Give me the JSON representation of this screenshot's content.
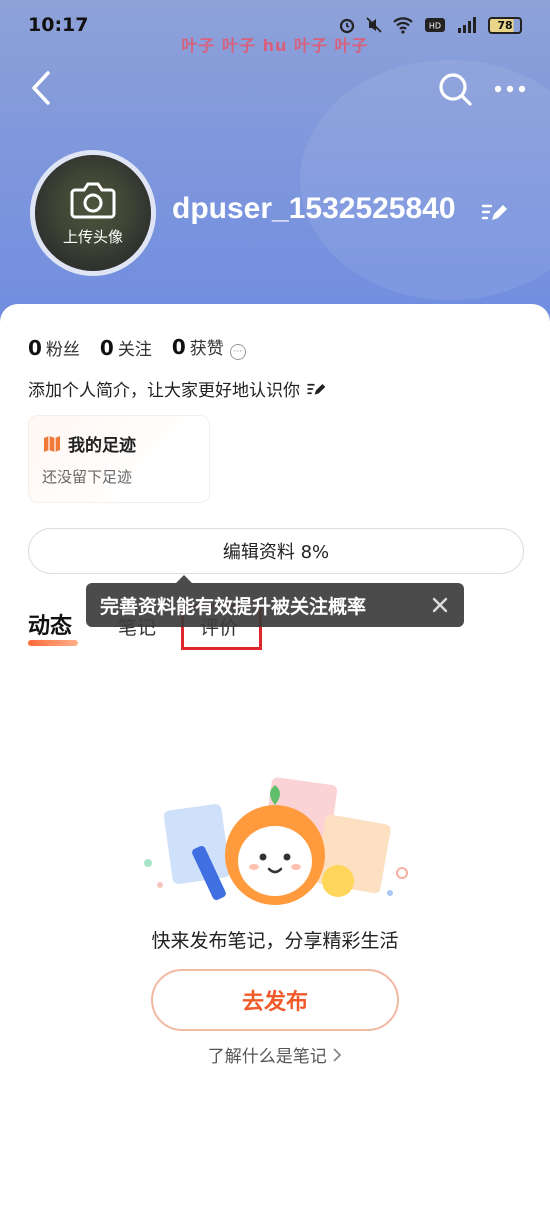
{
  "status_bar": {
    "time": "10:17",
    "battery": "78",
    "icons": [
      "alarm-icon",
      "mute-icon",
      "wifi-icon",
      "hd-icon",
      "signal-icon",
      "battery-icon"
    ]
  },
  "watermark": "叶子 叶子 hu 叶子 叶子",
  "nav": {
    "back_icon": "chevron-left-icon",
    "search_icon": "search-icon",
    "more_icon": "more-icon"
  },
  "profile": {
    "avatar_label": "上传头像",
    "username": "dpuser_1532525840"
  },
  "stats": [
    {
      "count": "0",
      "label": "粉丝"
    },
    {
      "count": "0",
      "label": "关注"
    },
    {
      "count": "0",
      "label": "获赞"
    }
  ],
  "bio_placeholder": "添加个人简介，让大家更好地认识你",
  "footprint": {
    "title": "我的足迹",
    "subtitle": "还没留下足迹"
  },
  "edit_profile_label": "编辑资料 8%",
  "tooltip": "完善资料能有效提升被关注概率",
  "tabs": [
    {
      "label": "动态",
      "active": true
    },
    {
      "label": "笔记",
      "active": false
    },
    {
      "label": "评价",
      "active": false
    }
  ],
  "empty_state": {
    "message": "快来发布笔记，分享精彩生活",
    "publish_label": "去发布",
    "learn_link": "了解什么是笔记"
  },
  "colors": {
    "header": "#7f97dc",
    "accent": "#f05a2a",
    "highlight": "#e0262d"
  }
}
